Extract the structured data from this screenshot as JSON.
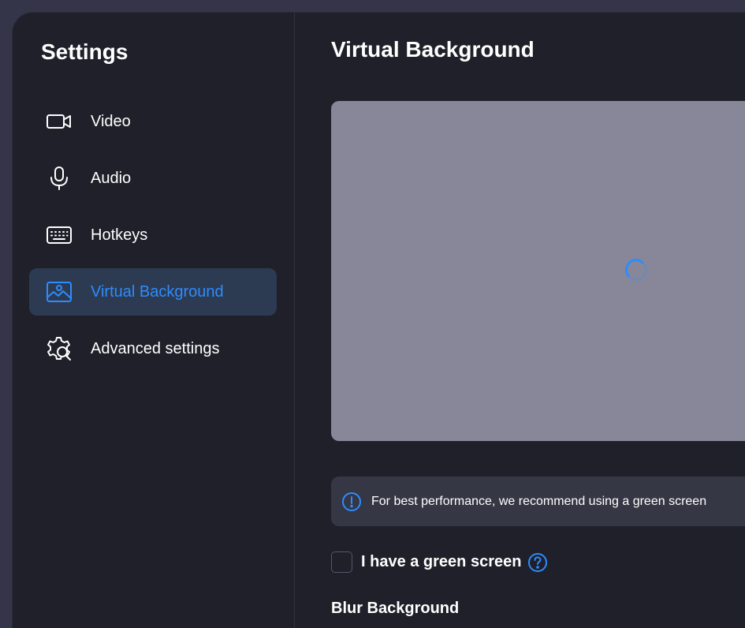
{
  "sidebar": {
    "title": "Settings",
    "items": [
      {
        "label": "Video",
        "icon": "video-camera-icon",
        "active": false
      },
      {
        "label": "Audio",
        "icon": "microphone-icon",
        "active": false
      },
      {
        "label": "Hotkeys",
        "icon": "keyboard-icon",
        "active": false
      },
      {
        "label": "Virtual Background",
        "icon": "image-portrait-icon",
        "active": true
      },
      {
        "label": "Advanced settings",
        "icon": "gear-search-icon",
        "active": false
      }
    ]
  },
  "main": {
    "title": "Virtual Background",
    "preview": {
      "loading": true
    },
    "notice": {
      "text": "For best performance, we recommend using a green screen",
      "icon": "info-icon"
    },
    "green_screen": {
      "label": "I have a green screen",
      "checked": false,
      "help_icon": "question-icon"
    },
    "blur_section": {
      "title": "Blur Background"
    }
  },
  "colors": {
    "accent": "#2d8cff",
    "background": "#1f2029",
    "active_item": "#2d3b52",
    "preview": "#878799",
    "notice_bg": "#353744"
  }
}
